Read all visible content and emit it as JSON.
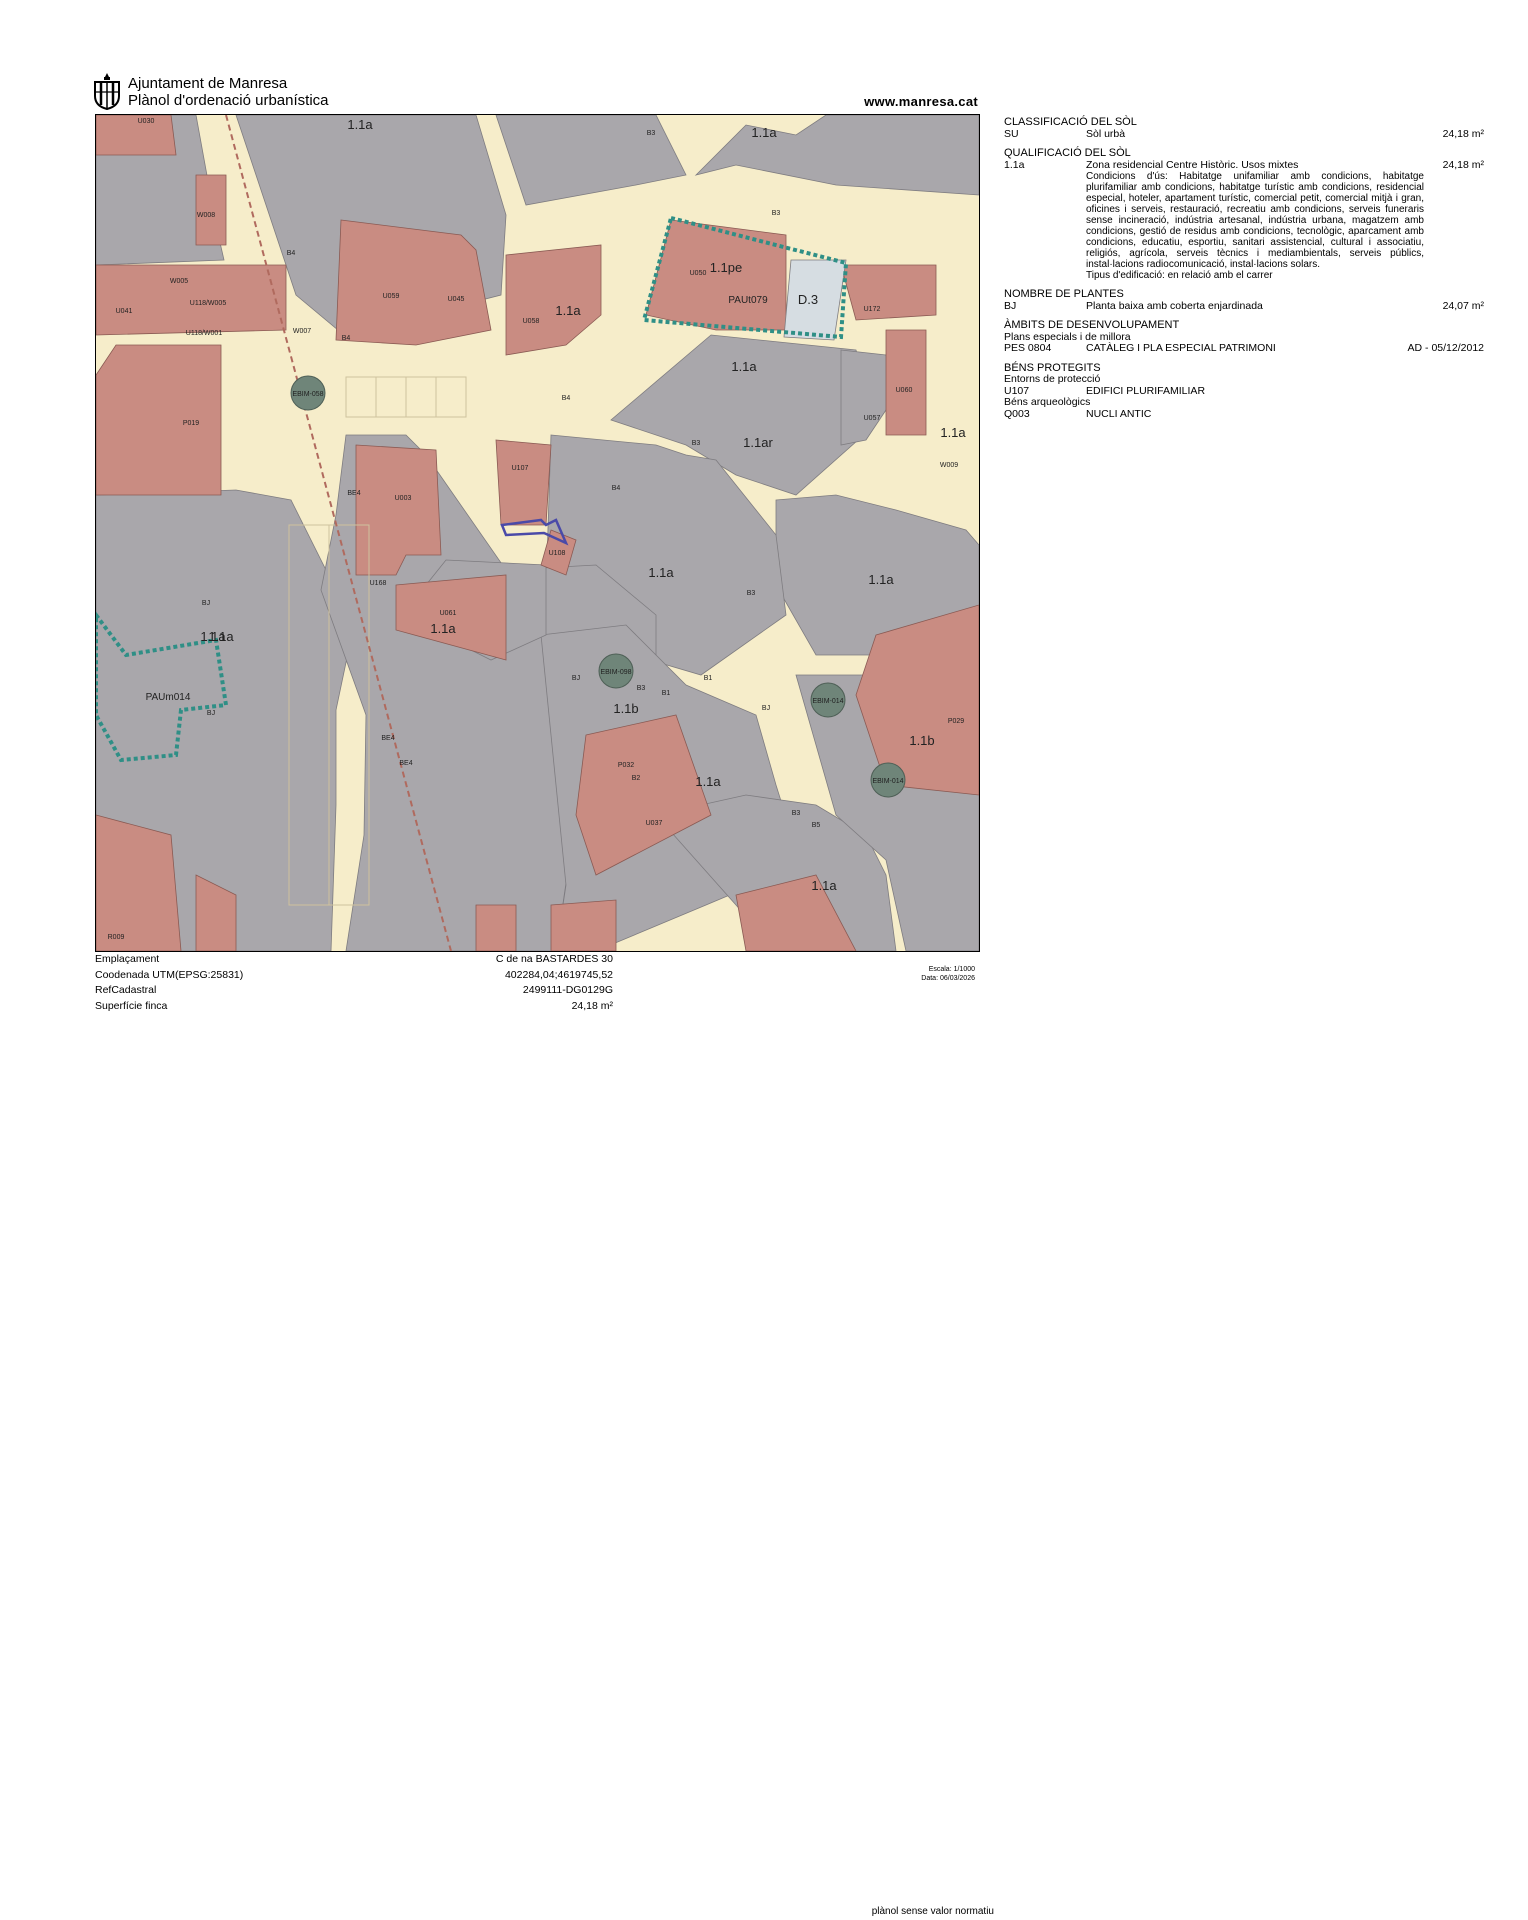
{
  "header": {
    "org": "Ajuntament de Manresa",
    "doc": "Plànol d'ordenació urbanística",
    "url": "www.manresa.cat"
  },
  "colors": {
    "street": "#f6edca",
    "building_grey": "#a9a7ab",
    "building_red": "#c98c82",
    "protected": "#d6dde2",
    "boundary": "#2f8f86",
    "tree": "#6f8579",
    "highlight": "#4a4aa8"
  },
  "info": {
    "s1": {
      "title": "CLASSIFICACIÓ DEL SÒL",
      "code": "SU",
      "text": "Sòl urbà",
      "value": "24,18 m²"
    },
    "s2": {
      "title": "QUALIFICACIÓ DEL SÒL",
      "code": "1.1a",
      "text": "Zona residencial Centre Històric. Usos mixtes",
      "value": "24,18 m²",
      "desc": "Condicions d'ús: Habitatge unifamiliar amb condicions, habitatge plurifamiliar amb condicions, habitatge turístic amb condicions, residencial especial, hoteler, apartament turístic, comercial petit, comercial mitjà i gran, oficines i serveis, restauració, recreatiu amb condicions, serveis funeraris sense incineració, indústria artesanal, indústria urbana, magatzem amb condicions, gestió de residus amb condicions, tecnològic, aparcament amb condicions, educatiu, esportiu, sanitari assistencial, cultural i associatiu, religiós, agrícola, serveis tècnics i mediambientals, serveis públics, instal·lacions radiocomunicació, instal·lacions solars.",
      "desc2": "Tipus d'edificació: en relació amb el carrer"
    },
    "s3": {
      "title": "NOMBRE DE PLANTES",
      "code": "BJ",
      "text": "Planta baixa amb coberta enjardinada",
      "value": "24,07 m²"
    },
    "s4": {
      "title": "ÀMBITS DE DESENVOLUPAMENT",
      "sub": "Plans especials i de millora",
      "code": "PES 0804",
      "text": "CATÀLEG I PLA ESPECIAL PATRIMONI",
      "value": "AD - 05/12/2012"
    },
    "s5": {
      "title": "BÉNS PROTEGITS",
      "sub1": "Entorns de protecció",
      "code1": "U107",
      "text1": "EDIFICI PLURIFAMILIAR",
      "sub2": "Béns arqueològics",
      "code2": "Q003",
      "text2": "NUCLI ANTIC"
    }
  },
  "footer": {
    "emplacament_label": "Emplaçament",
    "emplacament_value": "C de na BASTARDES 30",
    "utm_label": "Coodenada UTM(EPSG:25831)",
    "utm_value": "402284,04;4619745,52",
    "ref_label": "RefCadastral",
    "ref_value": "2499111-DG0129G",
    "sup_label": "Superfície finca",
    "sup_value": "24,18 m²",
    "normatiu": "plànol sense valor normatiu",
    "escala": "Escala: 1/1000",
    "data": "Data: 06/03/2026"
  },
  "map": {
    "zones": [
      "1.1a",
      "1.1a",
      "1.1a",
      "1.1a",
      "1.1a",
      "1.1ar",
      "1.1a",
      "1.1a",
      "1.1a",
      "1.1a",
      "1.1a",
      "1.1b",
      "1.1b",
      "1.1a",
      "1.1a",
      "1.1pe",
      "D.3"
    ],
    "pau": [
      "PAUt079",
      "PAUm014"
    ],
    "parcels": [
      "U030",
      "W008",
      "W005",
      "U118/W005",
      "U041",
      "U118/W001",
      "W007",
      "U059",
      "U045",
      "U058",
      "U050",
      "U172",
      "U060",
      "U057",
      "W009",
      "P019",
      "U107",
      "U003",
      "U108",
      "U168",
      "U061",
      "P032",
      "U037",
      "P029",
      "R009"
    ],
    "trees": [
      "EBIM-058",
      "EBIM-098",
      "EBIM-014",
      "EBIM-014"
    ],
    "floors": [
      "B3",
      "B4",
      "BJ",
      "B1",
      "BE4",
      "B2",
      "B5"
    ]
  }
}
